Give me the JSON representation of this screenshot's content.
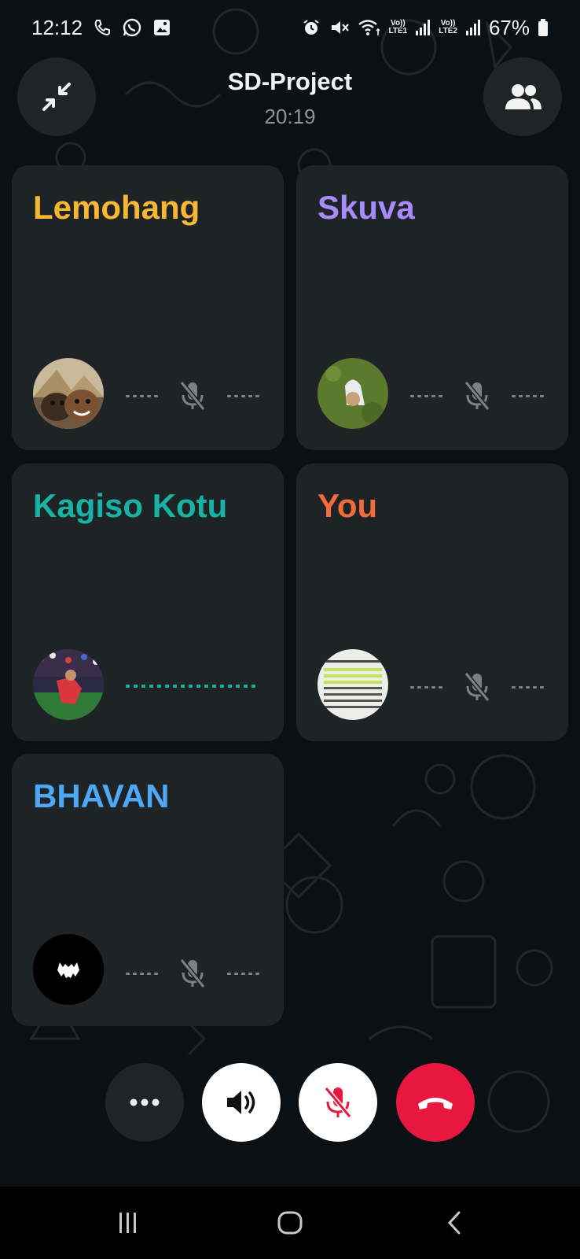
{
  "status_bar": {
    "time": "12:12",
    "battery": "67%",
    "sim1_label_top": "Vo))",
    "sim1_label_bottom": "LTE1",
    "sim2_label_top": "Vo))",
    "sim2_label_bottom": "LTE2",
    "left_icons": [
      "phone-icon",
      "whatsapp-icon",
      "gallery-icon"
    ],
    "right_icons": [
      "alarm-icon",
      "mute-icon",
      "wifi-icon",
      "signal-icon",
      "signal-icon",
      "battery-icon"
    ]
  },
  "header": {
    "title": "SD-Project",
    "duration": "20:19",
    "minimize_icon": "minimize-icon",
    "participants_icon": "participants-icon"
  },
  "participants": [
    {
      "name": "Lemohang",
      "color": "#f7b733",
      "muted": true,
      "speaking": false,
      "avatar": "dogs-photo"
    },
    {
      "name": "Skuva",
      "color": "#a78bfa",
      "muted": true,
      "speaking": false,
      "avatar": "grass-photo"
    },
    {
      "name": "Kagiso Kotu",
      "color": "#19b3a6",
      "muted": false,
      "speaking": true,
      "avatar": "football-photo"
    },
    {
      "name": "You",
      "color": "#f26b3a",
      "muted": true,
      "speaking": false,
      "avatar": "document-photo"
    },
    {
      "name": "BHAVAN",
      "color": "#4ea8f5",
      "muted": true,
      "speaking": false,
      "avatar": "bat-logo"
    }
  ],
  "controls": {
    "more_icon": "more-icon",
    "speaker_icon": "speaker-icon",
    "mic_icon": "mic-off-icon",
    "end_call_icon": "end-call-icon",
    "end_call_color": "#e8173f"
  },
  "nav": [
    "recents-icon",
    "home-icon",
    "back-icon"
  ]
}
